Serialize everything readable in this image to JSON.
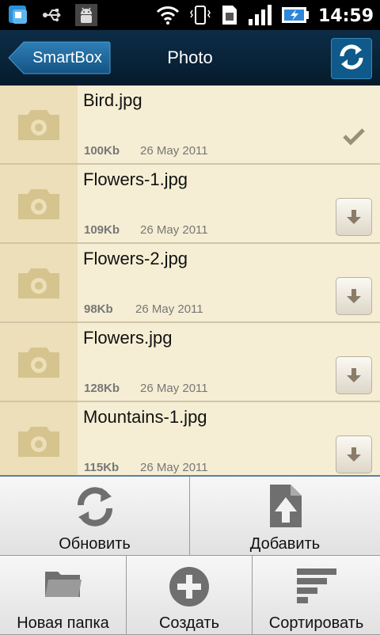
{
  "status_bar": {
    "time": "14:59"
  },
  "header": {
    "back_label": "SmartBox",
    "title": "Photo"
  },
  "files": [
    {
      "name": "Bird.jpg",
      "size": "100Kb",
      "date": "26 May 2011",
      "state": "downloaded"
    },
    {
      "name": "Flowers-1.jpg",
      "size": "109Kb",
      "date": "26 May 2011",
      "state": "download"
    },
    {
      "name": "Flowers-2.jpg",
      "size": "98Kb",
      "date": "26 May 2011",
      "state": "download"
    },
    {
      "name": "Flowers.jpg",
      "size": "128Kb",
      "date": "26 May 2011",
      "state": "download"
    },
    {
      "name": "Mountains-1.jpg",
      "size": "115Kb",
      "date": "26 May 2011",
      "state": "download"
    }
  ],
  "menu": {
    "refresh": "Обновить",
    "add": "Добавить",
    "new_folder": "Новая папка",
    "create": "Создать",
    "sort": "Сортировать"
  },
  "colors": {
    "header_bg": "#0a2438",
    "accent": "#0f5a8a",
    "list_bg": "#f5eed4",
    "thumb_bg": "#ecdfb9"
  }
}
